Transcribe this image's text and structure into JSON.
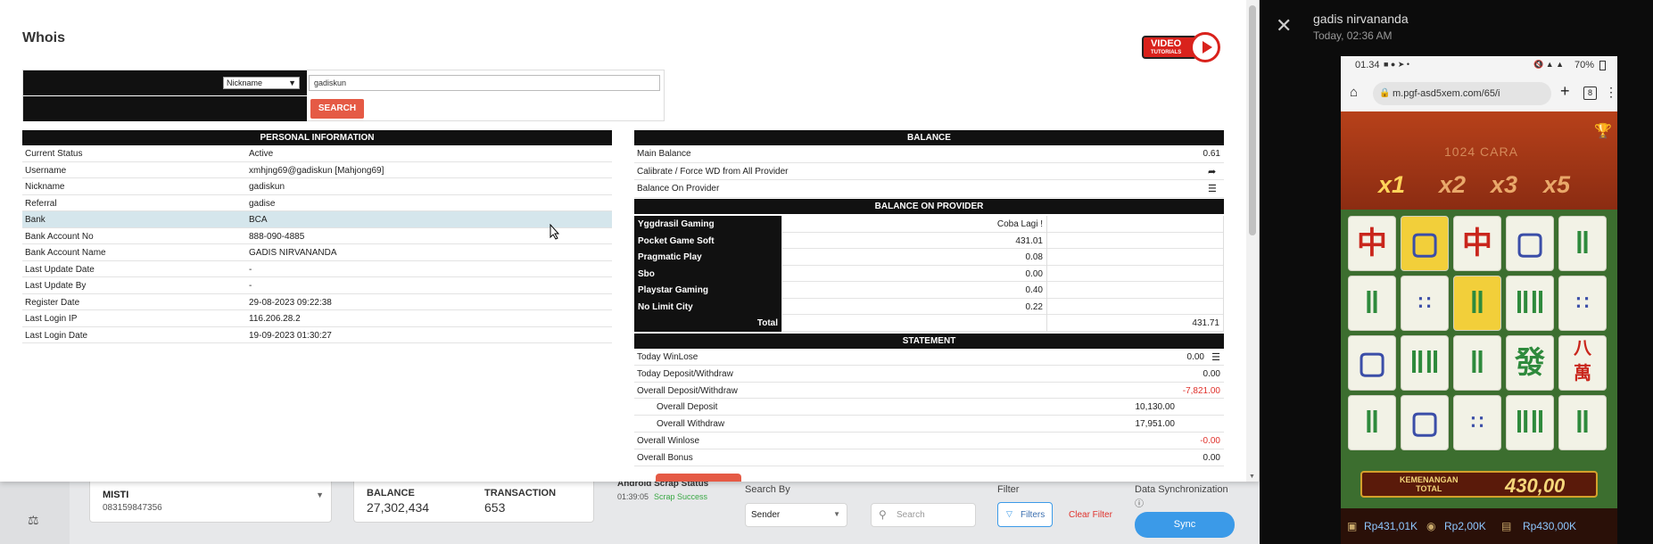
{
  "modal": {
    "title": "Whois",
    "video_badge": {
      "line1": "VIDEO",
      "line2": "TUTORIALS"
    },
    "search": {
      "select_value": "Nickname",
      "input_value": "gadiskun",
      "button": "SEARCH"
    },
    "personal": {
      "heading": "PERSONAL INFORMATION",
      "rows": [
        {
          "k": "Current Status",
          "v": "Active"
        },
        {
          "k": "Username",
          "v": "xmhjng69@gadiskun  [Mahjong69]"
        },
        {
          "k": "Nickname",
          "v": "gadiskun"
        },
        {
          "k": "Referral",
          "v": "gadise"
        },
        {
          "k": "Bank",
          "v": "BCA"
        },
        {
          "k": "Bank Account No",
          "v": "888-090-4885"
        },
        {
          "k": "Bank Account Name",
          "v": "GADIS NIRVANANDA"
        },
        {
          "k": "Last Update Date",
          "v": "-"
        },
        {
          "k": "Last Update By",
          "v": "-"
        },
        {
          "k": "Register Date",
          "v": "29-08-2023 09:22:38"
        },
        {
          "k": "Last Login IP",
          "v": "116.206.28.2"
        },
        {
          "k": "Last Login Date",
          "v": "19-09-2023 01:30:27"
        }
      ]
    },
    "balance": {
      "heading": "BALANCE",
      "main_label": "Main Balance",
      "main_value": "0.61",
      "calibrate_label": "Calibrate / Force WD from All Provider",
      "on_provider_label": "Balance On Provider"
    },
    "providers": {
      "heading": "BALANCE ON PROVIDER",
      "rows": [
        {
          "name": "Yggdrasil Gaming",
          "value": "Coba Lagi !"
        },
        {
          "name": "Pocket Game Soft",
          "value": "431.01"
        },
        {
          "name": "Pragmatic Play",
          "value": "0.08"
        },
        {
          "name": "Sbo",
          "value": "0.00"
        },
        {
          "name": "Playstar Gaming",
          "value": "0.40"
        },
        {
          "name": "No Limit City",
          "value": "0.22"
        }
      ],
      "total_label": "Total",
      "total_value": "431.71"
    },
    "statement": {
      "heading": "STATEMENT",
      "today_winlose_label": "Today WinLose",
      "today_winlose_value": "0.00",
      "today_dw_label": "Today Deposit/Withdraw",
      "today_dw_value": "0.00",
      "overall_dw_label": "Overall Deposit/Withdraw",
      "overall_dw_value": "-7,821.00",
      "overall_deposit_label": "Overall Deposit",
      "overall_deposit_value": "10,130.00",
      "overall_withdraw_label": "Overall Withdraw",
      "overall_withdraw_value": "17,951.00",
      "overall_winlose_label": "Overall Winlose",
      "overall_winlose_value": "-0.00",
      "overall_bonus_label": "Overall Bonus",
      "overall_bonus_value": "0.00"
    }
  },
  "bottom_bar": {
    "account_name": "MISTI",
    "account_phone": "083159847356",
    "balance_label": "BALANCE",
    "balance_value": "27,302,434",
    "transaction_label": "TRANSACTION",
    "transaction_value": "653",
    "scrap_title": "Android Scrap Status",
    "scrap_time": "01:39:05",
    "scrap_status": "Scrap Success",
    "search_by_label": "Search By",
    "search_by_value": "Sender",
    "search_placeholder": "Search",
    "filter_label": "Filter",
    "filters_button": "Filters",
    "clear_filter": "Clear Filter",
    "sync_label": "Data Synchronization",
    "sync_button": "Sync"
  },
  "viewer": {
    "sender": "gadis nirvananda",
    "time": "Today, 02:36 AM",
    "phone": {
      "clock": "01.34",
      "battery": "70%",
      "url": "m.pgf-asd5xem.com/65/i",
      "tabs": "8",
      "game_banner": "1024 CARA",
      "multipliers": [
        "x1",
        "x2",
        "x3",
        "x5"
      ],
      "win_label_1": "KEMENANGAN",
      "win_label_2": "TOTAL",
      "win_amount": "430,00",
      "stat1": "Rp431,01K",
      "stat2": "Rp2,00K",
      "stat3": "Rp430,00K"
    }
  },
  "colors": {
    "accent_red": "#e55a45",
    "header_black": "#111111",
    "highlight_row": "#d5e6ec",
    "negative": "#e0322c",
    "sync_blue": "#3b9ae8"
  }
}
